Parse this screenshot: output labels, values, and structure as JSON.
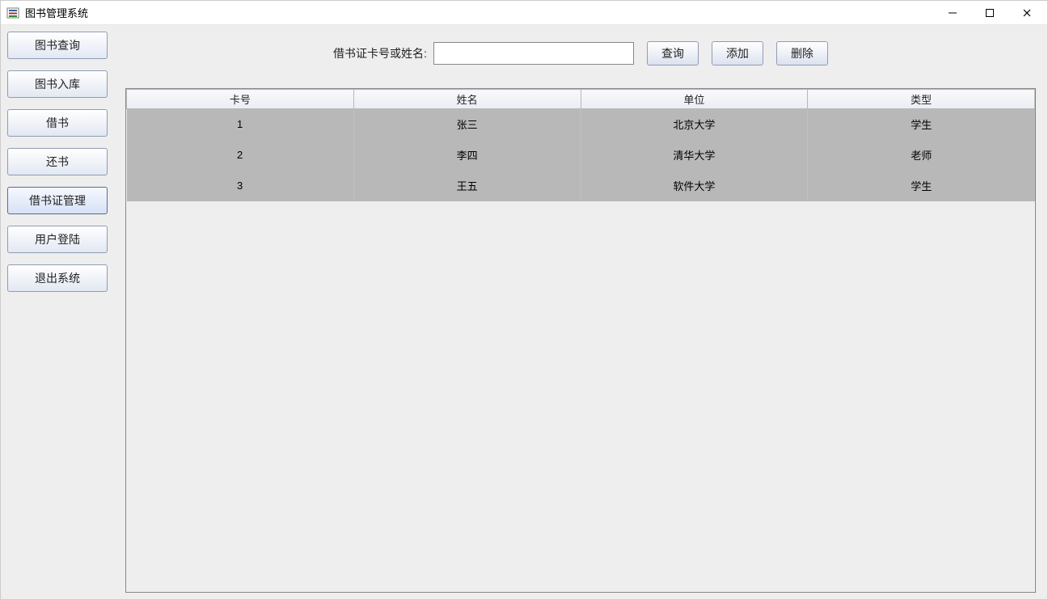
{
  "window": {
    "title": "图书管理系统"
  },
  "sidebar": {
    "items": [
      {
        "label": "图书查询",
        "active": false
      },
      {
        "label": "图书入库",
        "active": false
      },
      {
        "label": "借书",
        "active": false
      },
      {
        "label": "还书",
        "active": false
      },
      {
        "label": "借书证管理",
        "active": true
      },
      {
        "label": "用户登陆",
        "active": false
      },
      {
        "label": "退出系统",
        "active": false
      }
    ]
  },
  "search": {
    "label": "借书证卡号或姓名:",
    "value": "",
    "buttons": {
      "query": "查询",
      "add": "添加",
      "delete": "删除"
    }
  },
  "table": {
    "headers": [
      "卡号",
      "姓名",
      "单位",
      "类型"
    ],
    "rows": [
      {
        "cells": [
          "1",
          "张三",
          "北京大学",
          "学生"
        ],
        "selected": true
      },
      {
        "cells": [
          "2",
          "李四",
          "清华大学",
          "老师"
        ],
        "selected": true
      },
      {
        "cells": [
          "3",
          "王五",
          "软件大学",
          "学生"
        ],
        "selected": true
      }
    ]
  }
}
